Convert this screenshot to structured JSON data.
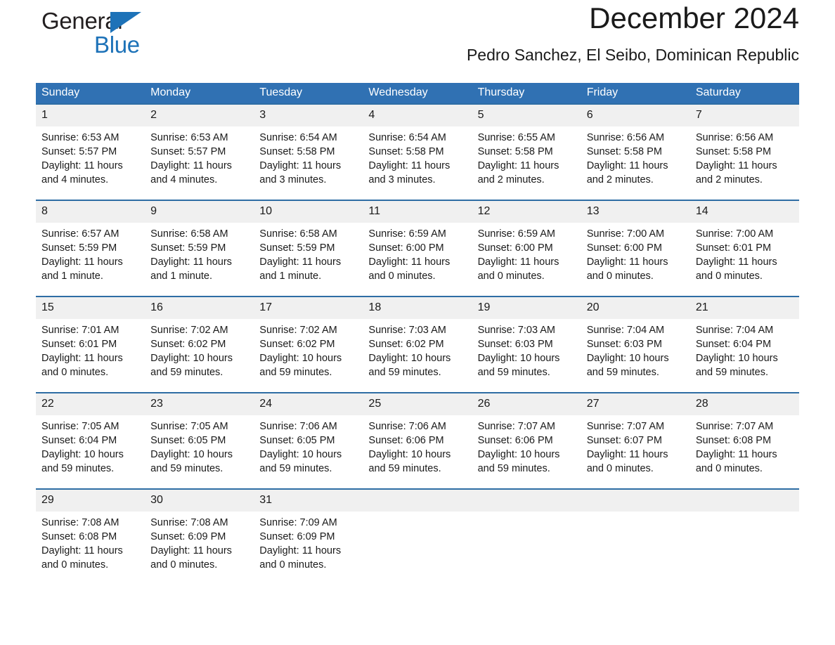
{
  "logo": {
    "word1": "General",
    "word2": "Blue",
    "triangle_color": "#1d72b8",
    "word1_color": "#231f20",
    "word2_color": "#1d72b8"
  },
  "header": {
    "title": "December 2024",
    "subtitle": "Pedro Sanchez, El Seibo, Dominican Republic"
  },
  "colors": {
    "header_blue": "#3071b3",
    "row_divider_blue": "#2e6da4",
    "daynum_band": "#f0f0f0"
  },
  "calendar": {
    "weekday_headers": [
      "Sunday",
      "Monday",
      "Tuesday",
      "Wednesday",
      "Thursday",
      "Friday",
      "Saturday"
    ],
    "weeks": [
      [
        {
          "day": "1",
          "sunrise": "Sunrise: 6:53 AM",
          "sunset": "Sunset: 5:57 PM",
          "daylight_line1": "Daylight: 11 hours",
          "daylight_line2": "and 4 minutes."
        },
        {
          "day": "2",
          "sunrise": "Sunrise: 6:53 AM",
          "sunset": "Sunset: 5:57 PM",
          "daylight_line1": "Daylight: 11 hours",
          "daylight_line2": "and 4 minutes."
        },
        {
          "day": "3",
          "sunrise": "Sunrise: 6:54 AM",
          "sunset": "Sunset: 5:58 PM",
          "daylight_line1": "Daylight: 11 hours",
          "daylight_line2": "and 3 minutes."
        },
        {
          "day": "4",
          "sunrise": "Sunrise: 6:54 AM",
          "sunset": "Sunset: 5:58 PM",
          "daylight_line1": "Daylight: 11 hours",
          "daylight_line2": "and 3 minutes."
        },
        {
          "day": "5",
          "sunrise": "Sunrise: 6:55 AM",
          "sunset": "Sunset: 5:58 PM",
          "daylight_line1": "Daylight: 11 hours",
          "daylight_line2": "and 2 minutes."
        },
        {
          "day": "6",
          "sunrise": "Sunrise: 6:56 AM",
          "sunset": "Sunset: 5:58 PM",
          "daylight_line1": "Daylight: 11 hours",
          "daylight_line2": "and 2 minutes."
        },
        {
          "day": "7",
          "sunrise": "Sunrise: 6:56 AM",
          "sunset": "Sunset: 5:58 PM",
          "daylight_line1": "Daylight: 11 hours",
          "daylight_line2": "and 2 minutes."
        }
      ],
      [
        {
          "day": "8",
          "sunrise": "Sunrise: 6:57 AM",
          "sunset": "Sunset: 5:59 PM",
          "daylight_line1": "Daylight: 11 hours",
          "daylight_line2": "and 1 minute."
        },
        {
          "day": "9",
          "sunrise": "Sunrise: 6:58 AM",
          "sunset": "Sunset: 5:59 PM",
          "daylight_line1": "Daylight: 11 hours",
          "daylight_line2": "and 1 minute."
        },
        {
          "day": "10",
          "sunrise": "Sunrise: 6:58 AM",
          "sunset": "Sunset: 5:59 PM",
          "daylight_line1": "Daylight: 11 hours",
          "daylight_line2": "and 1 minute."
        },
        {
          "day": "11",
          "sunrise": "Sunrise: 6:59 AM",
          "sunset": "Sunset: 6:00 PM",
          "daylight_line1": "Daylight: 11 hours",
          "daylight_line2": "and 0 minutes."
        },
        {
          "day": "12",
          "sunrise": "Sunrise: 6:59 AM",
          "sunset": "Sunset: 6:00 PM",
          "daylight_line1": "Daylight: 11 hours",
          "daylight_line2": "and 0 minutes."
        },
        {
          "day": "13",
          "sunrise": "Sunrise: 7:00 AM",
          "sunset": "Sunset: 6:00 PM",
          "daylight_line1": "Daylight: 11 hours",
          "daylight_line2": "and 0 minutes."
        },
        {
          "day": "14",
          "sunrise": "Sunrise: 7:00 AM",
          "sunset": "Sunset: 6:01 PM",
          "daylight_line1": "Daylight: 11 hours",
          "daylight_line2": "and 0 minutes."
        }
      ],
      [
        {
          "day": "15",
          "sunrise": "Sunrise: 7:01 AM",
          "sunset": "Sunset: 6:01 PM",
          "daylight_line1": "Daylight: 11 hours",
          "daylight_line2": "and 0 minutes."
        },
        {
          "day": "16",
          "sunrise": "Sunrise: 7:02 AM",
          "sunset": "Sunset: 6:02 PM",
          "daylight_line1": "Daylight: 10 hours",
          "daylight_line2": "and 59 minutes."
        },
        {
          "day": "17",
          "sunrise": "Sunrise: 7:02 AM",
          "sunset": "Sunset: 6:02 PM",
          "daylight_line1": "Daylight: 10 hours",
          "daylight_line2": "and 59 minutes."
        },
        {
          "day": "18",
          "sunrise": "Sunrise: 7:03 AM",
          "sunset": "Sunset: 6:02 PM",
          "daylight_line1": "Daylight: 10 hours",
          "daylight_line2": "and 59 minutes."
        },
        {
          "day": "19",
          "sunrise": "Sunrise: 7:03 AM",
          "sunset": "Sunset: 6:03 PM",
          "daylight_line1": "Daylight: 10 hours",
          "daylight_line2": "and 59 minutes."
        },
        {
          "day": "20",
          "sunrise": "Sunrise: 7:04 AM",
          "sunset": "Sunset: 6:03 PM",
          "daylight_line1": "Daylight: 10 hours",
          "daylight_line2": "and 59 minutes."
        },
        {
          "day": "21",
          "sunrise": "Sunrise: 7:04 AM",
          "sunset": "Sunset: 6:04 PM",
          "daylight_line1": "Daylight: 10 hours",
          "daylight_line2": "and 59 minutes."
        }
      ],
      [
        {
          "day": "22",
          "sunrise": "Sunrise: 7:05 AM",
          "sunset": "Sunset: 6:04 PM",
          "daylight_line1": "Daylight: 10 hours",
          "daylight_line2": "and 59 minutes."
        },
        {
          "day": "23",
          "sunrise": "Sunrise: 7:05 AM",
          "sunset": "Sunset: 6:05 PM",
          "daylight_line1": "Daylight: 10 hours",
          "daylight_line2": "and 59 minutes."
        },
        {
          "day": "24",
          "sunrise": "Sunrise: 7:06 AM",
          "sunset": "Sunset: 6:05 PM",
          "daylight_line1": "Daylight: 10 hours",
          "daylight_line2": "and 59 minutes."
        },
        {
          "day": "25",
          "sunrise": "Sunrise: 7:06 AM",
          "sunset": "Sunset: 6:06 PM",
          "daylight_line1": "Daylight: 10 hours",
          "daylight_line2": "and 59 minutes."
        },
        {
          "day": "26",
          "sunrise": "Sunrise: 7:07 AM",
          "sunset": "Sunset: 6:06 PM",
          "daylight_line1": "Daylight: 10 hours",
          "daylight_line2": "and 59 minutes."
        },
        {
          "day": "27",
          "sunrise": "Sunrise: 7:07 AM",
          "sunset": "Sunset: 6:07 PM",
          "daylight_line1": "Daylight: 11 hours",
          "daylight_line2": "and 0 minutes."
        },
        {
          "day": "28",
          "sunrise": "Sunrise: 7:07 AM",
          "sunset": "Sunset: 6:08 PM",
          "daylight_line1": "Daylight: 11 hours",
          "daylight_line2": "and 0 minutes."
        }
      ],
      [
        {
          "day": "29",
          "sunrise": "Sunrise: 7:08 AM",
          "sunset": "Sunset: 6:08 PM",
          "daylight_line1": "Daylight: 11 hours",
          "daylight_line2": "and 0 minutes."
        },
        {
          "day": "30",
          "sunrise": "Sunrise: 7:08 AM",
          "sunset": "Sunset: 6:09 PM",
          "daylight_line1": "Daylight: 11 hours",
          "daylight_line2": "and 0 minutes."
        },
        {
          "day": "31",
          "sunrise": "Sunrise: 7:09 AM",
          "sunset": "Sunset: 6:09 PM",
          "daylight_line1": "Daylight: 11 hours",
          "daylight_line2": "and 0 minutes."
        },
        {
          "day": "",
          "sunrise": "",
          "sunset": "",
          "daylight_line1": "",
          "daylight_line2": ""
        },
        {
          "day": "",
          "sunrise": "",
          "sunset": "",
          "daylight_line1": "",
          "daylight_line2": ""
        },
        {
          "day": "",
          "sunrise": "",
          "sunset": "",
          "daylight_line1": "",
          "daylight_line2": ""
        },
        {
          "day": "",
          "sunrise": "",
          "sunset": "",
          "daylight_line1": "",
          "daylight_line2": ""
        }
      ]
    ]
  }
}
